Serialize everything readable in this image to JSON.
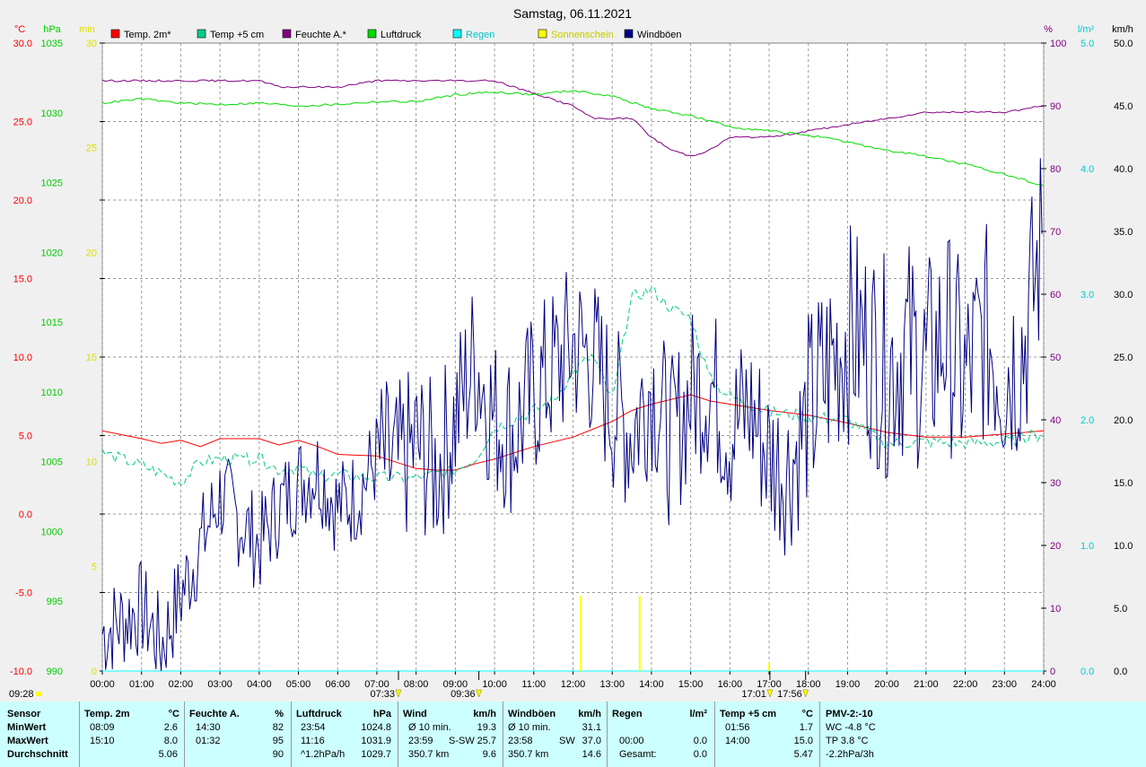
{
  "chart_data": {
    "type": "line",
    "title": "Samstag, 06.11.2021",
    "x_axis": {
      "range": [
        "00:00",
        "24:00"
      ],
      "tick_labels": [
        "00:00",
        "01:00",
        "02:00",
        "03:00",
        "04:00",
        "05:00",
        "06:00",
        "07:00",
        "08:00",
        "09:00",
        "10:00",
        "11:00",
        "12:00",
        "13:00",
        "14:00",
        "15:00",
        "16:00",
        "17:00",
        "18:00",
        "19:00",
        "20:00",
        "21:00",
        "22:00",
        "23:00",
        "24:00"
      ]
    },
    "y_axes": [
      {
        "unit": "°C",
        "color": "#ff0000",
        "range": [
          -10,
          30
        ],
        "tick_labels": [
          "30.0",
          "25.0",
          "20.0",
          "15.0",
          "10.0",
          "5.0",
          "0.0",
          "-5.0",
          "-10.0"
        ]
      },
      {
        "unit": "hPa",
        "color": "#00cc00",
        "range": [
          990,
          1035
        ],
        "tick_labels": [
          "1035",
          "1030",
          "1025",
          "1020",
          "1015",
          "1010",
          "1005",
          "1000",
          "995",
          "990"
        ]
      },
      {
        "unit": "min",
        "color": "#dddd00",
        "range": [
          0,
          30
        ],
        "tick_labels": [
          "30",
          "25",
          "20",
          "15",
          "10",
          "5",
          "0"
        ]
      },
      {
        "unit": "%",
        "color": "#800080",
        "range": [
          0,
          100
        ],
        "tick_labels": [
          "100",
          "90",
          "80",
          "70",
          "60",
          "50",
          "40",
          "30",
          "20",
          "10",
          "0"
        ]
      },
      {
        "unit": "l/m²",
        "color": "#00cccc",
        "range": [
          0,
          5
        ],
        "tick_labels": [
          "5.0",
          "4.0",
          "3.0",
          "2.0",
          "1.0",
          "0.0"
        ]
      },
      {
        "unit": "km/h",
        "color": "#000000",
        "range": [
          0,
          50
        ],
        "tick_labels": [
          "50.0",
          "45.0",
          "40.0",
          "35.0",
          "30.0",
          "25.0",
          "20.0",
          "15.0",
          "10.0",
          "5.0",
          "0.0"
        ]
      }
    ],
    "legend": [
      {
        "name": "Temp. 2m*",
        "color": "#ff0000"
      },
      {
        "name": "Temp +5 cm",
        "color": "#00cc88"
      },
      {
        "name": "Feuchte A.*",
        "color": "#800080"
      },
      {
        "name": "Luftdruck",
        "color": "#00dd00"
      },
      {
        "name": "Regen",
        "color": "#00ffff"
      },
      {
        "name": "Sonnenschein",
        "color": "#ffff00"
      },
      {
        "name": "Windböen",
        "color": "#000080"
      }
    ],
    "legend_position": "top",
    "grid": true,
    "series": [
      {
        "name": "Temp. 2m*",
        "color": "#ff0000",
        "axis": "°C",
        "x": [
          0,
          1,
          1.5,
          2,
          2.5,
          3,
          4,
          4.5,
          5,
          5.5,
          6,
          7,
          7.5,
          8,
          8.5,
          9,
          9.5,
          10,
          11,
          12,
          12.5,
          13,
          13.5,
          14,
          15,
          15.5,
          16,
          17,
          18,
          19,
          20,
          21,
          22,
          23,
          24
        ],
        "y": [
          5.3,
          4.8,
          4.5,
          4.7,
          4.3,
          4.8,
          4.8,
          4.4,
          4.7,
          4.3,
          3.8,
          3.7,
          3.3,
          2.9,
          2.8,
          2.8,
          3.2,
          3.5,
          4.3,
          4.9,
          5.4,
          5.9,
          6.6,
          7.0,
          7.6,
          7.2,
          7.0,
          6.6,
          6.3,
          5.8,
          5.2,
          4.9,
          4.9,
          5.1,
          5.3
        ]
      },
      {
        "name": "Temp +5 cm",
        "color": "#00cc88",
        "axis": "°C",
        "x": [
          0,
          0.5,
          1,
          1.5,
          2,
          2.5,
          3,
          4,
          4.5,
          5,
          5.5,
          6,
          7,
          7.5,
          8,
          9,
          9.5,
          10,
          10.5,
          11,
          11.5,
          12,
          12.5,
          13,
          13.5,
          14,
          14.5,
          15,
          15.5,
          16,
          17,
          18,
          19,
          20,
          21,
          22,
          23,
          24
        ],
        "y": [
          3.9,
          3.5,
          3.1,
          2.6,
          2.0,
          3.3,
          3.5,
          3.5,
          2.8,
          3.0,
          2.3,
          2.5,
          2.3,
          2.3,
          2.3,
          2.8,
          3.5,
          5.5,
          6.0,
          6.6,
          7.2,
          9.1,
          10.1,
          7.2,
          13.8,
          14.3,
          13.1,
          12.5,
          8.5,
          7.5,
          6.5,
          6.2,
          6.0,
          4.5,
          4.6,
          4.5,
          4.6,
          5.1
        ]
      },
      {
        "name": "Feuchte A.*",
        "color": "#800080",
        "axis": "%",
        "x": [
          0,
          2.5,
          3,
          4,
          4.5,
          5,
          6,
          7,
          8,
          9,
          10,
          11,
          11.5,
          12,
          12.5,
          13,
          13.5,
          14,
          14.5,
          15,
          15.5,
          16,
          17,
          18,
          19,
          20,
          21,
          22,
          23,
          24
        ],
        "y": [
          94,
          94,
          94,
          94,
          93,
          93,
          93,
          94,
          94,
          94,
          94,
          92,
          91,
          90,
          88,
          88,
          88,
          85,
          83,
          82,
          83,
          85,
          85,
          86,
          87,
          88,
          89,
          89,
          89,
          90
        ]
      },
      {
        "name": "Luftdruck",
        "color": "#00dd00",
        "axis": "hPa",
        "x": [
          0,
          1,
          2,
          3,
          4,
          5,
          6,
          7,
          8,
          9,
          10,
          11,
          12,
          13,
          14,
          15,
          16,
          17,
          18,
          19,
          20,
          21,
          22,
          23,
          24
        ],
        "y": [
          1030.7,
          1031.0,
          1030.7,
          1030.6,
          1030.7,
          1030.5,
          1030.6,
          1030.8,
          1030.8,
          1031.3,
          1031.5,
          1031.3,
          1031.6,
          1031.2,
          1030.3,
          1029.8,
          1029.0,
          1028.7,
          1028.4,
          1027.9,
          1027.3,
          1026.9,
          1026.3,
          1025.6,
          1024.8
        ]
      },
      {
        "name": "Regen",
        "color": "#00ffff",
        "axis": "l/m²",
        "x": [
          0,
          24
        ],
        "y": [
          0,
          0
        ]
      },
      {
        "name": "Windböen",
        "color": "#000080",
        "axis": "km/h",
        "x": [
          0,
          1,
          1.5,
          2,
          2.5,
          3,
          3.5,
          4,
          4.5,
          5,
          5.5,
          6,
          6.5,
          7,
          7.5,
          8,
          8.5,
          9,
          9.5,
          10,
          10.5,
          11,
          11.5,
          12,
          12.5,
          13,
          13.5,
          14,
          14.5,
          15,
          15.5,
          16,
          16.5,
          17,
          17.5,
          18,
          18.5,
          19,
          19.5,
          20,
          20.5,
          21,
          21.5,
          22,
          22.5,
          23,
          23.5,
          24
        ],
        "y": [
          3,
          5,
          2,
          6,
          10,
          14,
          12,
          10,
          13,
          15,
          16,
          13,
          14,
          17,
          16,
          18,
          16,
          20,
          25,
          20,
          19,
          22,
          24,
          26,
          25,
          21,
          19,
          23,
          18,
          22,
          23,
          19,
          21,
          17,
          16,
          20,
          24,
          27,
          26,
          24,
          26,
          24,
          27,
          23,
          27,
          24,
          26,
          35
        ]
      }
    ],
    "sunshine": {
      "x": [
        12.2,
        13.7,
        17.0
      ],
      "y": [
        3.6,
        3.6,
        0.4
      ]
    },
    "time_markers": [
      {
        "label": "07:33",
        "x": 7.55
      },
      {
        "label": "09:36",
        "x": 9.6
      },
      {
        "label": "17:01",
        "x": 17.02
      },
      {
        "label": "17:56",
        "x": 17.93
      }
    ],
    "corner_time": "09:28"
  },
  "stats": {
    "sensor": {
      "head": "Sensor",
      "rows": [
        "MinWert",
        "MaxWert",
        "Durchschnitt"
      ]
    },
    "temp2m": {
      "head": "Temp. 2m",
      "unit": "°C",
      "rows": [
        {
          "t": "08:09",
          "v": "2.6"
        },
        {
          "t": "15:10",
          "v": "8.0"
        },
        {
          "t": "",
          "v": "5.06"
        }
      ]
    },
    "feuchte": {
      "head": "Feuchte A.",
      "unit": "%",
      "rows": [
        {
          "t": "14:30",
          "v": "82"
        },
        {
          "t": "01:32",
          "v": "95"
        },
        {
          "t": "",
          "v": "90"
        }
      ]
    },
    "luftdruck": {
      "head": "Luftdruck",
      "unit": "hPa",
      "rows": [
        {
          "t": "23:54",
          "v": "1024.8"
        },
        {
          "t": "11:16",
          "v": "1031.9"
        },
        {
          "t": "^1.2hPa/h",
          "v": "1029.7"
        }
      ]
    },
    "wind": {
      "head": "Wind",
      "unit": "km/h",
      "rows": [
        {
          "t": "Ø 10 min.",
          "m": "",
          "v": "19.3"
        },
        {
          "t": "23:59",
          "m": "S-SW",
          "v": "25.7"
        },
        {
          "t": "350.7 km",
          "m": "",
          "v": "9.6"
        }
      ]
    },
    "windboeen": {
      "head": "Windböen",
      "unit": "km/h",
      "rows": [
        {
          "t": "Ø 10 min.",
          "m": "",
          "v": "31.1"
        },
        {
          "t": "23:58",
          "m": "SW",
          "v": "37.0"
        },
        {
          "t": "350.7 km",
          "m": "",
          "v": "14.6"
        }
      ]
    },
    "regen": {
      "head": "Regen",
      "unit": "l/m²",
      "rows": [
        {
          "t": "",
          "v": ""
        },
        {
          "t": "00:00",
          "v": "0.0"
        },
        {
          "t": "Gesamt:",
          "v": "0.0"
        }
      ]
    },
    "temp5": {
      "head": "Temp +5 cm",
      "unit": "°C",
      "rows": [
        {
          "t": "01:56",
          "v": "1.7"
        },
        {
          "t": "14:00",
          "v": "15.0"
        },
        {
          "t": "",
          "v": "5.47"
        }
      ]
    },
    "pmv": {
      "head": "PMV-2:-10",
      "rows": [
        "WC -4.8 °C",
        "TP 3.8 °C",
        "-2.2hPa/3h"
      ]
    }
  }
}
